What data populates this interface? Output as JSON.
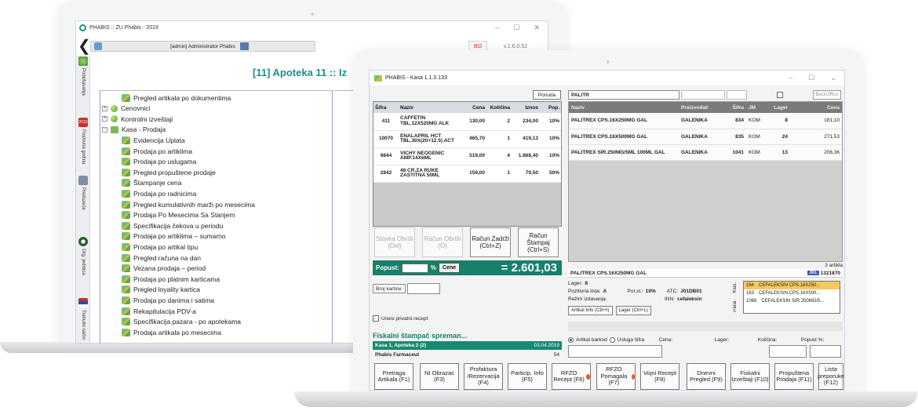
{
  "back_window": {
    "title": "PHABIS :: ZU Phabis - 2019",
    "user": "[admin] Administrator Phabis",
    "db": "BO",
    "version": "v.1.6.0.52",
    "heading": "[11] Apoteka 11 :: Iz",
    "sidebar": [
      {
        "label": "Podešavanja",
        "icon": "gear-icon"
      },
      {
        "label": "Poslovna godina",
        "icon": "calendar-icon",
        "badge": "2010"
      },
      {
        "label": "Preduzeće",
        "icon": "building-icon"
      },
      {
        "label": "Org. jedinica",
        "icon": "org-icon"
      },
      {
        "label": "Trenutni način",
        "icon": "flag-icon"
      }
    ],
    "tree": [
      {
        "label": "Pregled artikala po dokumentima",
        "level": 2,
        "kind": "leaf"
      },
      {
        "label": "Cenovnici",
        "level": 0,
        "kind": "node"
      },
      {
        "label": "Kontrolni izveštaji",
        "level": 0,
        "kind": "node"
      },
      {
        "label": "Kasa - Prodaja",
        "level": 0,
        "kind": "folder"
      },
      {
        "label": "Evidencija Uplata",
        "level": 1,
        "kind": "leaf"
      },
      {
        "label": "Prodaja po artiklima",
        "level": 1,
        "kind": "leaf"
      },
      {
        "label": "Prodaja po uslugama",
        "level": 1,
        "kind": "leaf"
      },
      {
        "label": "Pregled propuštene prodaje",
        "level": 1,
        "kind": "leaf"
      },
      {
        "label": "Štampanje cena",
        "level": 1,
        "kind": "leaf"
      },
      {
        "label": "Prodaja po radnicima",
        "level": 1,
        "kind": "leaf"
      },
      {
        "label": "Pregled kumulativnih marži po mesecima",
        "level": 1,
        "kind": "leaf"
      },
      {
        "label": "Prodaja Po Mesecima Sa Stanjem",
        "level": 1,
        "kind": "leaf"
      },
      {
        "label": "Specifikacija čekova u periodu",
        "level": 1,
        "kind": "leaf"
      },
      {
        "label": "Prodaja po artiklima – sumarno",
        "level": 1,
        "kind": "leaf"
      },
      {
        "label": "Prodaja po artikal tipu",
        "level": 1,
        "kind": "leaf"
      },
      {
        "label": "Pregled računa na dan",
        "level": 1,
        "kind": "leaf"
      },
      {
        "label": "Vezana prodaja – period",
        "level": 1,
        "kind": "leaf"
      },
      {
        "label": "Prodaja po platnim karticama",
        "level": 1,
        "kind": "leaf"
      },
      {
        "label": "Pregled loyality kartica",
        "level": 1,
        "kind": "leaf"
      },
      {
        "label": "Prodaja po danima i satima",
        "level": 1,
        "kind": "leaf"
      },
      {
        "label": "Rekapitulacija PDV-a",
        "level": 1,
        "kind": "leaf"
      },
      {
        "label": "Specifikacija pazara - po apotekama",
        "level": 1,
        "kind": "leaf"
      },
      {
        "label": "Prodaja artikala po mesecima",
        "level": 1,
        "kind": "leaf"
      }
    ]
  },
  "front_window": {
    "title": "PHABIS - Kasa 1.1.0.133",
    "ponuda_label": "Ponuda",
    "cart": {
      "headers": [
        "Šifra",
        "Naziv",
        "Cena",
        "Količina",
        "Iznos",
        "Pop."
      ],
      "rows": [
        {
          "sifra": "411",
          "naziv": "CAFFETIN TBL.12X520MG ALK",
          "cena": "130,00",
          "kolicina": "2",
          "iznos": "234,00",
          "pop": "10%"
        },
        {
          "sifra": "10070",
          "naziv": "ENALAPRIL HCT TBL.30X(20+12.5) ACT",
          "cena": "465,70",
          "kolicina": "1",
          "iznos": "419,13",
          "pop": "10%"
        },
        {
          "sifra": "9844",
          "naziv": "VICHY NEOGENIC AMP.14X6ML",
          "cena": "519,00",
          "kolicina": "4",
          "iznos": "1.868,40",
          "pop": "10%"
        },
        {
          "sifra": "2842",
          "naziv": "48 CR.ZA RUKE ZASTITNA 50ML",
          "cena": "159,00",
          "kolicina": "1",
          "iznos": "79,50",
          "pop": "50%"
        }
      ]
    },
    "action_buttons": [
      {
        "label": "Stavka Obriši (Del)",
        "disabled": true
      },
      {
        "label": "Račun Obriši (O)",
        "disabled": true
      },
      {
        "label": "Račun Zadrži (Ctrl+Z)",
        "disabled": false
      },
      {
        "label": "Račun Štampaj (Ctrl+S)",
        "disabled": false
      }
    ],
    "popust_label": "Popust:",
    "percent_label": "%",
    "cene_label": "Cene",
    "total": "= 2.601,03",
    "broj_kartice_label": "Broj kartice:",
    "privatni_recept_label": "Unesi privatni recept",
    "fiscal_status": "Fiskalni štampač spreman...",
    "kasa_info": "Kasa 1, Apoteka 2 (2)",
    "kasa_date": "03.04.2019",
    "company": "Phabis Farmaceut",
    "company_num": "54",
    "search_value": "PALITR",
    "backoffice_label": "BackOffice",
    "results": {
      "headers": [
        "Naziv",
        "Proizvođač",
        "Šifra",
        "JM",
        "Lager",
        "Cena"
      ],
      "rows": [
        {
          "naziv": "PALITREX CPS.16X250MG GAL",
          "proizvodjac": "GALENIKA",
          "sifra": "834",
          "jm": "KOM",
          "lager": "8",
          "cena": "181,10"
        },
        {
          "naziv": "PALITREX CPS.16X500MG GAL",
          "proizvodjac": "GALENIKA",
          "sifra": "835",
          "jm": "KOM",
          "lager": "24",
          "cena": "271,53"
        },
        {
          "naziv": "PALITREX SIR.250MG/5ML 100ML GAL",
          "proizvodjac": "GALENIKA",
          "sifra": "1041",
          "jm": "KOM",
          "lager": "13",
          "cena": "206,36"
        }
      ]
    },
    "artikla_count": "3 artikla",
    "selected_name": "PALITREX CPS.16X250MG GAL",
    "jkl_tag": "JKL",
    "jkl_code": "1321870",
    "lager_label": "Lager:",
    "lager_value": "8",
    "pozitivna_label": "Pozitivna lista:",
    "pozitivna_value": "A",
    "por_label": "Por.st.:",
    "por_value": "10%",
    "atc_label": "ATC:",
    "atc_value": "J01DB01",
    "rezim_label": "Režim izdavanja:",
    "inn_label": "INN:",
    "inn_value": "cefaleksin",
    "artikal_info_btn": "Artikal Info (Ctrl+I)",
    "lager_btn": "Lager (Ctrl+L)",
    "klas_label": "Klas.",
    "paral_label": "Paral.",
    "alternatives": [
      {
        "code": "164",
        "name": "CEFALEKSIN CPS.16X250..."
      },
      {
        "code": "163",
        "name": "CEFALEKSIN CPS.16X500..."
      },
      {
        "code": "1068",
        "name": "CEFALEKSIN SIR.250MG/5..."
      }
    ],
    "entry": {
      "barkod_label": "Artikal barkod",
      "usluga_label": "Usluga šifra",
      "cena_label": "Cena:",
      "lager_label": "Lager:",
      "kolicina_label": "Količina:",
      "popust_label": "Popust %:"
    },
    "fkeys": [
      {
        "label": "Pretraga Artikala (F1)",
        "badge": false
      },
      {
        "label": "NI Obrazac (F3)",
        "badge": false
      },
      {
        "label": "Profaktura /Rezervacija (F4)",
        "badge": false
      },
      {
        "label": "Particip. Info (F5)",
        "badge": false
      },
      {
        "label": "RFZO Recept (F6)",
        "badge": true
      },
      {
        "label": "RFZO Pomagala (F7)",
        "badge": true
      },
      {
        "label": "Vojni Recept (F8)",
        "badge": false
      },
      {
        "label": "Dnevni Pregled (F9)",
        "badge": false
      },
      {
        "label": "Fiskalni Izveštaji (F10)",
        "badge": false
      },
      {
        "label": "Propuštena Prodaja (F11)",
        "badge": false
      },
      {
        "label": "Lista preporuke (F12)",
        "badge": false
      }
    ]
  },
  "colors": {
    "accent": "#17806a",
    "heading": "#1f8f8a",
    "badge": "#e0632b",
    "selection": "#f6c85f"
  }
}
